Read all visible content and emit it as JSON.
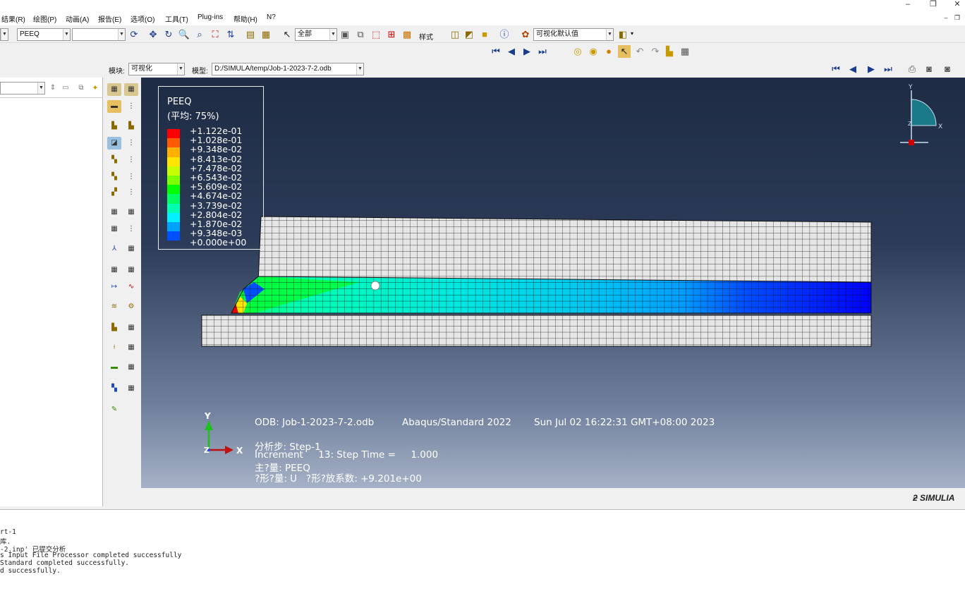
{
  "window": {
    "minimize": "–",
    "restore": "❐",
    "close": "✕"
  },
  "menu": [
    "结果(R)",
    "绘图(P)",
    "动画(A)",
    "报告(E)",
    "选项(O)",
    "工具(T)",
    "Plug-ins",
    "帮助(H)",
    "N?"
  ],
  "toolbar": {
    "field_output_combo": "PEEQ",
    "second_combo": "",
    "selection_combo": "全部",
    "render_label": "样式",
    "view_combo": "可视化默认值"
  },
  "context": {
    "module_label": "模块:",
    "module_value": "可视化",
    "model_label": "模型:",
    "model_value": "D:/SIMULA/temp/Job-1-2023-7-2.odb"
  },
  "legend": {
    "title": "PEEQ",
    "subtitle": "(平均: 75%)",
    "values": [
      "+1.122e-01",
      "+1.028e-01",
      "+9.348e-02",
      "+8.413e-02",
      "+7.478e-02",
      "+6.543e-02",
      "+5.609e-02",
      "+4.674e-02",
      "+3.739e-02",
      "+2.804e-02",
      "+1.870e-02",
      "+9.348e-03",
      "+0.000e+00"
    ],
    "colors": [
      "#ff0000",
      "#ff5a00",
      "#ffb000",
      "#ffe600",
      "#c8ff00",
      "#7cff00",
      "#00ff00",
      "#00ff60",
      "#00ffb0",
      "#00f0ff",
      "#00a0ff",
      "#0050ff",
      "#0000ff"
    ]
  },
  "triad_small": {
    "y": "Y",
    "x": "X",
    "z": "Z"
  },
  "triad_main": {
    "y": "Y",
    "x": "X",
    "z": "Z"
  },
  "info": {
    "odb": "ODB: Job-1-2023-7-2.odb",
    "solver": "Abaqus/Standard 2022",
    "date": "Sun Jul 02 16:22:31 GMT+08:00 2023",
    "step": "分析步: Step-1",
    "increment": "Increment     13: Step Time =     1.000",
    "primary": "主?量: PEEQ",
    "deformed": "?形?量: U   ?形?放系数: +9.201e+00"
  },
  "brand": "SIMULIA",
  "console": [
    "rt-1",
    "库.",
    "-2.inp' 已提交分析",
    "s Input File Processor completed successfully",
    "Standard completed successfully.",
    "d successfully."
  ]
}
